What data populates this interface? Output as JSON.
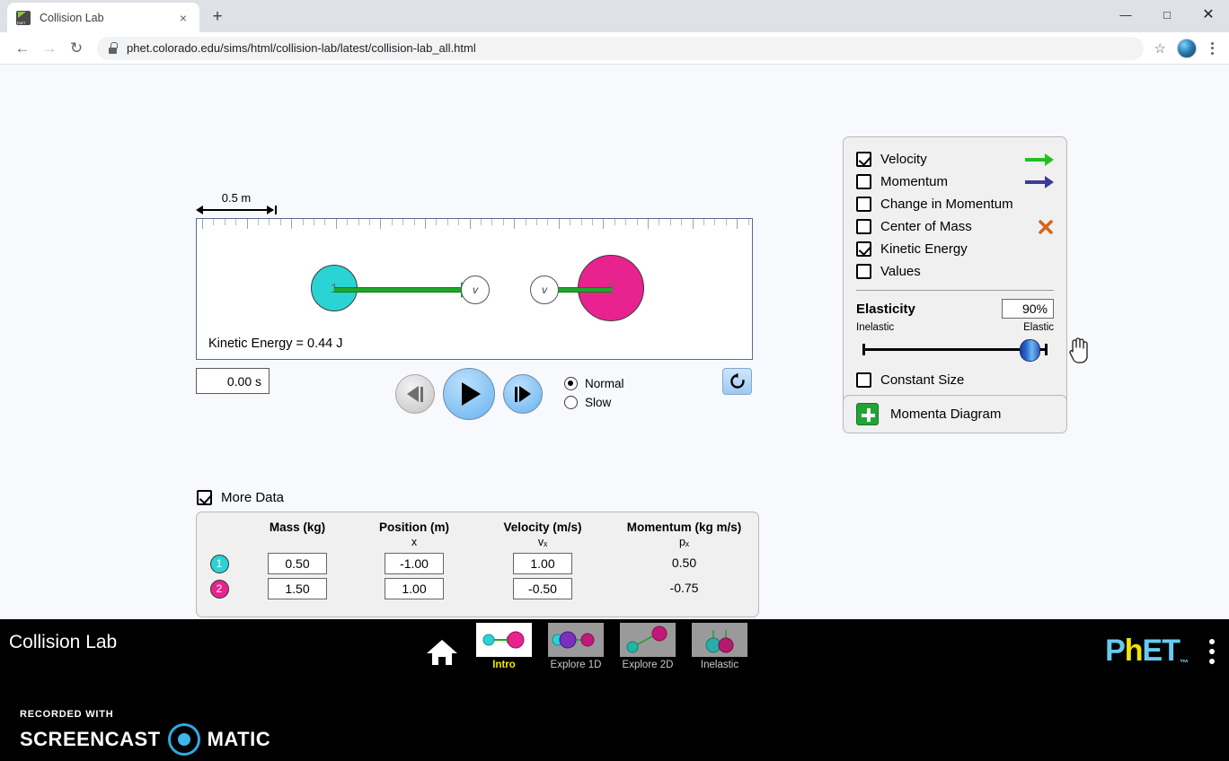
{
  "browser": {
    "tab": {
      "title": "Collision Lab",
      "favicon": "phet-favicon",
      "close": "×"
    },
    "new_tab": "+",
    "window": {
      "minimize": "—",
      "maximize": "□",
      "close": "✕"
    },
    "nav": {
      "back": "←",
      "forward": "→",
      "reload": "↻"
    },
    "url": "phet.colorado.edu/sims/html/collision-lab/latest/collision-lab_all.html",
    "bookmark": "☆",
    "lock": "lock-icon",
    "menu": "kebab-menu"
  },
  "sim": {
    "scalebar_label": "0.5 m",
    "kinetic_energy_readout": "Kinetic Energy = 0.44 J",
    "time_value": "0.00 s",
    "balls": [
      {
        "num": "1",
        "color": "#2ad4d4",
        "label_v": "v"
      },
      {
        "num": "2",
        "color": "#e8238f",
        "label_v": "v"
      }
    ],
    "playback": {
      "step_back": "step-backward",
      "play": "play",
      "step_forward": "step-forward",
      "restart": "↺"
    },
    "speed": {
      "options": [
        {
          "label": "Normal",
          "selected": true
        },
        {
          "label": "Slow",
          "selected": false
        }
      ]
    },
    "reset_all": "⟳"
  },
  "checkbox_panel": {
    "items": [
      {
        "label": "Velocity",
        "checked": true,
        "icon": "green-arrow-icon",
        "color": "#22c022"
      },
      {
        "label": "Momentum",
        "checked": false,
        "icon": "purple-arrow-icon",
        "color": "#3b3b99"
      },
      {
        "label": "Change in Momentum",
        "checked": false,
        "icon": "",
        "color": ""
      },
      {
        "label": "Center of Mass",
        "checked": false,
        "icon": "x-marker-icon",
        "color": "#d4661e"
      },
      {
        "label": "Kinetic Energy",
        "checked": true,
        "icon": "",
        "color": ""
      },
      {
        "label": "Values",
        "checked": false,
        "icon": "",
        "color": ""
      }
    ],
    "elasticity": {
      "title": "Elasticity",
      "value": "90%",
      "min_label": "Inelastic",
      "max_label": "Elastic",
      "percent": 90
    },
    "constant_size": {
      "label": "Constant Size",
      "checked": false
    }
  },
  "momenta_panel": {
    "label": "Momenta Diagram",
    "expand": "+"
  },
  "data_table": {
    "more_data": {
      "label": "More Data",
      "checked": true
    },
    "columns": [
      "Mass (kg)",
      "Position (m)",
      "Velocity (m/s)",
      "Momentum (kg m/s)"
    ],
    "subheaders": [
      "",
      "x",
      "vₓ",
      "pₓ"
    ],
    "rows": [
      {
        "id": "1",
        "color": "#2ad4d4",
        "mass": "0.50",
        "position": "-1.00",
        "velocity": "1.00",
        "momentum": "0.50"
      },
      {
        "id": "2",
        "color": "#e8238f",
        "mass": "1.50",
        "position": "1.00",
        "velocity": "-0.50",
        "momentum": "-0.75"
      }
    ]
  },
  "navbar": {
    "title": "Collision Lab",
    "home": "home-icon",
    "items": [
      {
        "label": "Intro",
        "active": true
      },
      {
        "label": "Explore 1D",
        "active": false
      },
      {
        "label": "Explore 2D",
        "active": false
      },
      {
        "label": "Inelastic",
        "active": false
      }
    ],
    "logo": {
      "p": "P",
      "h": "h",
      "et": "ET",
      "tm": "™"
    }
  },
  "watermark": {
    "recorded_with": "RECORDED WITH",
    "brand_left": "SCREENCAST",
    "brand_right": "MATIC"
  },
  "colors": {
    "ball1": "#2ad4d4",
    "ball2": "#e8238f",
    "velocity_green": "#1ea82a",
    "momentum_purple": "#3b3b99",
    "com_orange": "#d4661e",
    "accent_blue": "#8dc7f5",
    "phet_yellow": "#f2e400",
    "phet_cyan": "#66cbf2"
  }
}
